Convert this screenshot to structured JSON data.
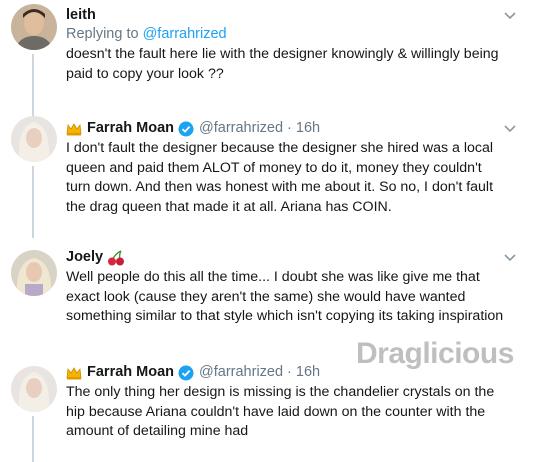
{
  "tweets": [
    {
      "name": "leith",
      "replying_prefix": "Replying to ",
      "replying_handle": "@farrahrized",
      "text": "doesn't the fault here lie with the designer knowingly & willingly being paid to copy your look ??",
      "avatar_icon": "user-photo-avatar"
    },
    {
      "name": "Farrah Moan",
      "handle": "@farrahrized",
      "separator": "·",
      "time": "16h",
      "text": "I don't fault the designer because the designer she hired was a local queen and paid them ALOT of money to do it, money they couldn't turn down. And then was honest with me about it. So no, I don't fault the drag queen that made it at all. Ariana has COIN.",
      "avatar_icon": "user-photo-avatar"
    },
    {
      "name": "Joely",
      "text": "Well people do this all the time... I doubt she was like give me that exact look (cause they aren't the same) she would have wanted something similar to that style which isn't copying its taking inspiration",
      "avatar_icon": "user-photo-avatar"
    },
    {
      "name": "Farrah Moan",
      "handle": "@farrahrized",
      "separator": "·",
      "time": "16h",
      "text": "The only thing her design is missing is the chandelier crystals on the hip because Ariana couldn't have laid down on the counter with the amount of detailing mine had",
      "avatar_icon": "user-photo-avatar"
    }
  ],
  "watermark": {
    "text": "Draglicious"
  },
  "colors": {
    "text": "#14171a",
    "secondary": "#657786",
    "link": "#1da1f2",
    "thread_line": "#ccd6dd",
    "verified": "#1da1f2"
  }
}
